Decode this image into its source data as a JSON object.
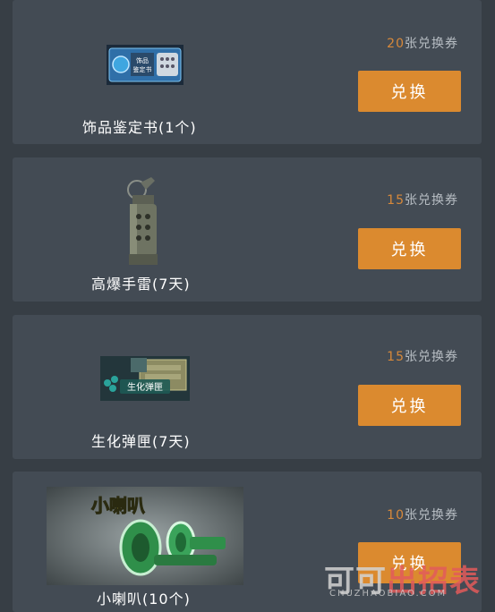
{
  "items": [
    {
      "name": "饰品鉴定书(1个)",
      "cost_num": "20",
      "cost_suffix": "张兑换券",
      "button": "兑换",
      "icon_text": "饰品\n鉴定书"
    },
    {
      "name": "高爆手雷(7天)",
      "cost_num": "15",
      "cost_suffix": "张兑换券",
      "button": "兑换"
    },
    {
      "name": "生化弹匣(7天)",
      "cost_num": "15",
      "cost_suffix": "张兑换券",
      "button": "兑换",
      "icon_text": "生化弹匣"
    },
    {
      "name": "小喇叭(10个)",
      "cost_num": "10",
      "cost_suffix": "张兑换券",
      "button": "兑换",
      "icon_text": "小喇叭"
    }
  ],
  "watermark": {
    "main_a": "可可",
    "main_b": "出招表",
    "sub": "CHUZHAOBIAO.COM"
  },
  "colors": {
    "accent": "#db8a2f",
    "card": "#434b54",
    "page": "#373e45"
  }
}
